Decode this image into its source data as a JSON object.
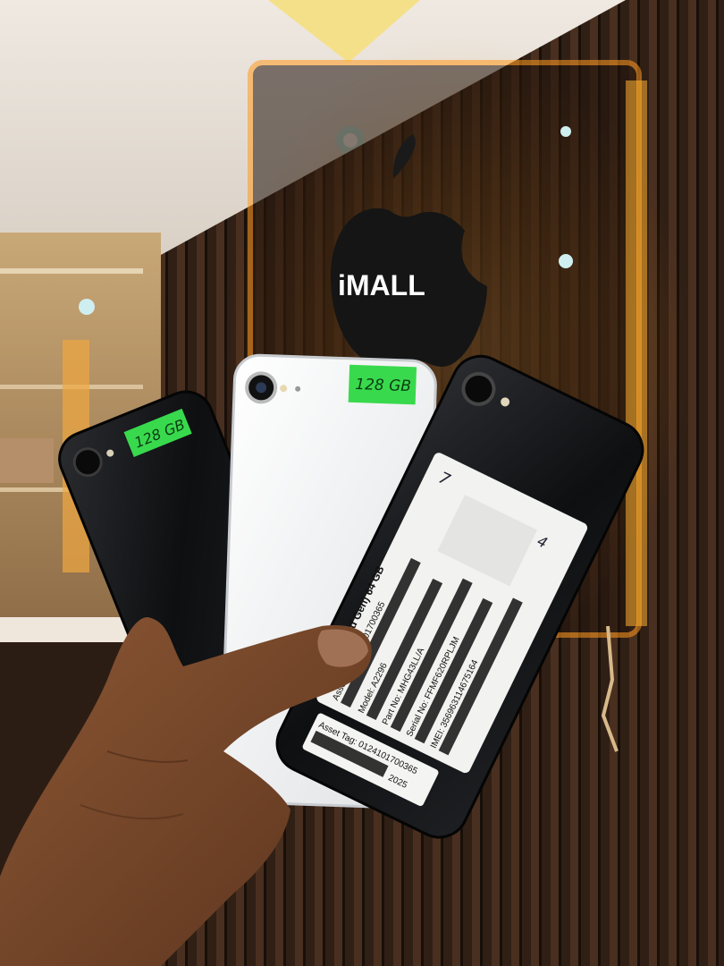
{
  "sign": {
    "brand": "iMALL"
  },
  "stickers": {
    "white_phone": "128 GB",
    "left_phone": "128 GB"
  },
  "label": {
    "line1": "iPhone SE (2nd Gen) 64 GB",
    "line2": "Asset Tag: 0124101700365",
    "line3": "Model: A2296",
    "line4": "Part No: MHG43LL/A",
    "line5": "Serial No: FFMF620RPLJM",
    "line6": "IMEI: 356963114675164",
    "handwriting_1": "7",
    "handwriting_2": "4"
  },
  "asset_tag": {
    "line1": "Asset Tag: 0124101700365",
    "year": "2025"
  },
  "colors": {
    "wall_slat": "#3a2519",
    "glow": "#ff9a1f",
    "sticker_green": "#39d94d",
    "phone_black": "#121316",
    "phone_white": "#eef0f1",
    "skin": "#7a4a2c"
  }
}
